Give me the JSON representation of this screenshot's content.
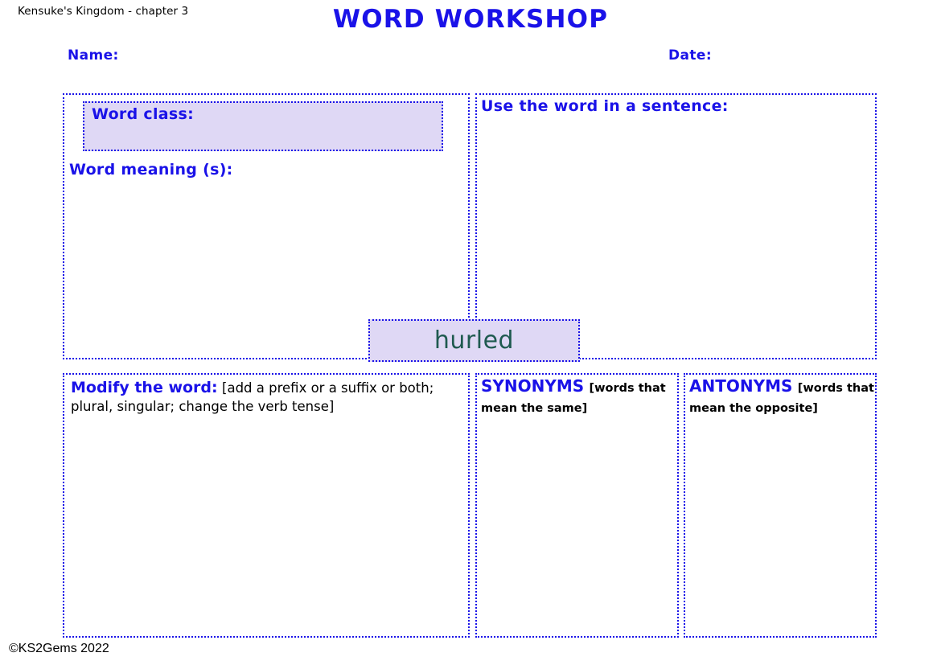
{
  "header": {
    "book_reference": "Kensuke's Kingdom - chapter 3",
    "title": "WORD WORKSHOP",
    "name_label": "Name:",
    "date_label": "Date:"
  },
  "focus_word": "hurled",
  "panels": {
    "word_class": {
      "label": "Word class:"
    },
    "word_meaning": {
      "label": "Word meaning (s):"
    },
    "sentence": {
      "label": "Use the word in a sentence:"
    },
    "modify": {
      "label": "Modify the word:",
      "note": "[add a prefix or a suffix or both; plural, singular; change the verb tense]"
    },
    "synonyms": {
      "label": "SYNONYMS",
      "note": "[words that mean the same]"
    },
    "antonyms": {
      "label": "ANTONYMS",
      "note": "[words that mean the opposite]"
    }
  },
  "footer": {
    "copyright": "©KS2Gems 2022"
  },
  "colors": {
    "accent_blue": "#1a12e8",
    "panel_fill": "#dfd8f5",
    "focus_word_text": "#1f5a50"
  }
}
